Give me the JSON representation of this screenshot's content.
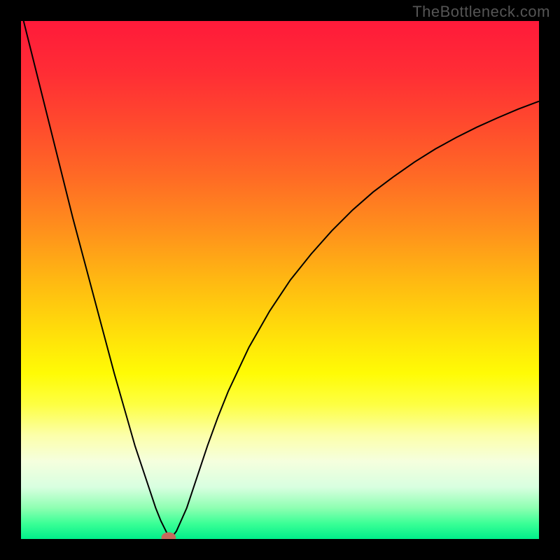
{
  "watermark": "TheBottleneck.com",
  "chart_data": {
    "type": "line",
    "title": "",
    "xlabel": "",
    "ylabel": "",
    "xlim": [
      0,
      100
    ],
    "ylim": [
      0,
      100
    ],
    "background_gradient": {
      "stops": [
        {
          "offset": 0.0,
          "color": "#ff1a3a"
        },
        {
          "offset": 0.1,
          "color": "#ff2d35"
        },
        {
          "offset": 0.2,
          "color": "#ff4a2d"
        },
        {
          "offset": 0.3,
          "color": "#ff6a25"
        },
        {
          "offset": 0.4,
          "color": "#ff8f1c"
        },
        {
          "offset": 0.5,
          "color": "#ffb812"
        },
        {
          "offset": 0.6,
          "color": "#ffde0a"
        },
        {
          "offset": 0.68,
          "color": "#fffb05"
        },
        {
          "offset": 0.74,
          "color": "#fdff42"
        },
        {
          "offset": 0.8,
          "color": "#fcffaa"
        },
        {
          "offset": 0.85,
          "color": "#f5ffde"
        },
        {
          "offset": 0.9,
          "color": "#d8ffe0"
        },
        {
          "offset": 0.94,
          "color": "#8effb2"
        },
        {
          "offset": 0.97,
          "color": "#3bff96"
        },
        {
          "offset": 1.0,
          "color": "#00ef8a"
        }
      ]
    },
    "series": [
      {
        "name": "bottleneck-curve",
        "color": "#000000",
        "width": 2,
        "x": [
          0,
          2,
          4,
          6,
          8,
          10,
          12,
          14,
          16,
          18,
          20,
          22,
          24,
          26,
          27,
          28,
          28.5,
          29,
          30,
          32,
          34,
          36,
          38,
          40,
          44,
          48,
          52,
          56,
          60,
          64,
          68,
          72,
          76,
          80,
          84,
          88,
          92,
          96,
          100
        ],
        "y": [
          102,
          94,
          86,
          78,
          70,
          62,
          54.5,
          47,
          39.5,
          32,
          25,
          18,
          12,
          6,
          3.5,
          1.5,
          0.5,
          0.2,
          1.5,
          6,
          12,
          18,
          23.5,
          28.5,
          37,
          44,
          50,
          55,
          59.5,
          63.5,
          67,
          70,
          72.8,
          75.3,
          77.5,
          79.5,
          81.3,
          83,
          84.5
        ]
      }
    ],
    "marker": {
      "x": 28.5,
      "y": 0.3,
      "rx": 1.4,
      "ry": 1.0,
      "fill": "#c66a5c"
    }
  }
}
